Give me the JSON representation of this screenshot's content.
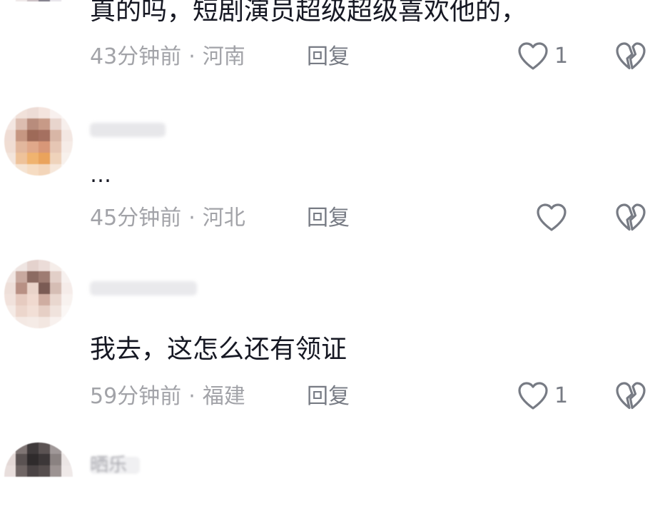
{
  "comments": [
    {
      "text": "真的吗，短剧演员超级超级喜欢他的，",
      "time": "43分钟前",
      "location": "河南",
      "reply_label": "回复",
      "like_count": "1"
    },
    {
      "username": "",
      "text": "…",
      "time": "45分钟前",
      "location": "河北",
      "reply_label": "回复",
      "like_count": ""
    },
    {
      "username": "",
      "text": "我去，这怎么还有领证",
      "time": "59分钟前",
      "location": "福建",
      "reply_label": "回复",
      "like_count": "1"
    },
    {
      "username": "晒乐"
    }
  ],
  "separator": "·",
  "icons": {
    "like": "heart-outline-icon",
    "dislike": "broken-heart-icon"
  },
  "colors": {
    "text": "#161823",
    "meta": "#a2a3a8",
    "icon": "#777b84"
  }
}
